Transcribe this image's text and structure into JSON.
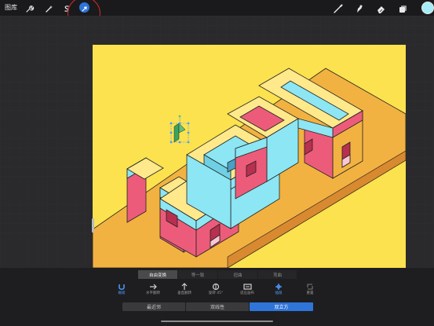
{
  "topbar": {
    "gallery_label": "图库",
    "left_tools": [
      "wrench-icon",
      "magic-wand-icon",
      "selection-icon",
      "transform-arrow-icon"
    ],
    "active_tool": "transform-arrow-icon",
    "right_tools": [
      "brush-icon",
      "smudge-icon",
      "eraser-icon",
      "layers-icon"
    ],
    "color": "#a6ecf7"
  },
  "transform": {
    "mode_tabs": [
      {
        "label": "自由变换",
        "active": true
      },
      {
        "label": "等一致",
        "active": false
      },
      {
        "label": "扭曲",
        "active": false
      },
      {
        "label": "弯曲",
        "active": false
      }
    ],
    "actions": [
      {
        "label": "磁吸",
        "icon": "magnet-icon",
        "active": true
      },
      {
        "label": "水平翻转",
        "icon": "flip-horizontal-icon",
        "active": false
      },
      {
        "label": "垂直翻转",
        "icon": "flip-vertical-icon",
        "active": false
      },
      {
        "label": "旋转 45°",
        "icon": "rotate-icon",
        "active": false
      },
      {
        "label": "适应画布",
        "icon": "fit-canvas-icon",
        "active": false
      },
      {
        "label": "插值",
        "icon": "interpolation-icon",
        "active": true
      },
      {
        "label": "重置",
        "icon": "reset-icon",
        "active": false
      }
    ],
    "interpolation_options": [
      {
        "label": "最近邻",
        "active": false
      },
      {
        "label": "双线性",
        "active": false
      },
      {
        "label": "双立方",
        "active": true
      }
    ]
  },
  "colors": {
    "accent": "#2e74d9",
    "canvas_bg": "#fbe24e",
    "platform": "#f2b241",
    "cyan": "#8ce6f4",
    "pink": "#ec5c7a",
    "yellow_top": "#ffe98a"
  }
}
